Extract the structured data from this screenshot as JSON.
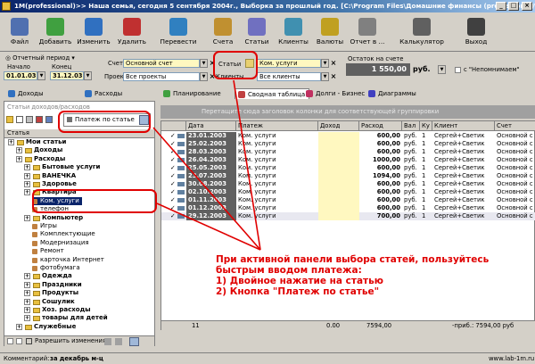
{
  "window": {
    "title": "1М(professional)>> Наша семья, сегодня 5 сентября 2004г., Выборка за прошлый год. [C:\\Program Files\\Домашние финансы (professional)\\0..."
  },
  "toolbar": {
    "items": [
      {
        "label": "Файл",
        "icon": "file-icon",
        "color": "#5070b0"
      },
      {
        "label": "Добавить",
        "icon": "add-icon",
        "color": "#40a040"
      },
      {
        "label": "Изменить",
        "icon": "edit-icon",
        "color": "#3070c0"
      },
      {
        "label": "Удалить",
        "icon": "delete-icon",
        "color": "#c03030"
      },
      {
        "label": "Перевести",
        "icon": "transfer-icon",
        "color": "#3080c0"
      },
      {
        "label": "Счета",
        "icon": "accounts-icon",
        "color": "#c09030"
      },
      {
        "label": "Статьи",
        "icon": "articles-icon",
        "color": "#7070c0"
      },
      {
        "label": "Клиенты",
        "icon": "clients-icon",
        "color": "#4090b0"
      },
      {
        "label": "Валюты",
        "icon": "currency-icon",
        "color": "#c0a020"
      },
      {
        "label": "Отчет в ...",
        "icon": "report-icon",
        "color": "#808080"
      },
      {
        "label": "Калькулятор",
        "icon": "calculator-icon",
        "color": "#606060"
      },
      {
        "label": "Выход",
        "icon": "exit-icon",
        "color": "#404040"
      }
    ]
  },
  "filters": {
    "period_label": "Отчетный период",
    "start_label": "Начало",
    "end_label": "Конец",
    "start_value": "01.01.03",
    "end_value": "31.12.03",
    "account_label": "Счет",
    "account_value": "Основной счет",
    "project_label": "Проект",
    "project_value": "Все проекты",
    "articles_label": "Статьи",
    "articles_value": "Ком. услуги",
    "clients_label": "Клиенты",
    "clients_value": "Все клиенты",
    "balance_label": "Остаток на счете",
    "balance_value": "1 550,00",
    "currency": "руб.",
    "unmemorable_label": "с \"Непомнимаем\""
  },
  "tabs": [
    {
      "label": "Доходы",
      "color": "#3070c0"
    },
    {
      "label": "Расходы",
      "color": "#3070c0"
    },
    {
      "label": "Планирование",
      "color": "#40a040"
    },
    {
      "label": "Сводная таблица",
      "color": "#c04040"
    },
    {
      "label": "Долги - Бизнес",
      "color": "#c03060"
    },
    {
      "label": "Диаграммы",
      "color": "#4040c0"
    }
  ],
  "left": {
    "header": "Статьи доходов/расходов",
    "button_label": "Платеж по статье",
    "col_header": "Статья",
    "tree": [
      {
        "label": "Мои статьи",
        "level": 0,
        "type": "exp",
        "bold": true
      },
      {
        "label": "Доходы",
        "level": 1,
        "type": "exp",
        "bold": true
      },
      {
        "label": "Расходы",
        "level": 1,
        "type": "exp",
        "bold": true
      },
      {
        "label": "Бытовые услуги",
        "level": 2,
        "type": "exp",
        "bold": true
      },
      {
        "label": "ВАНЕЧКА",
        "level": 2,
        "type": "exp",
        "bold": true
      },
      {
        "label": "Здоровье",
        "level": 2,
        "type": "exp",
        "bold": true
      },
      {
        "label": "Квартира",
        "level": 2,
        "type": "exp",
        "bold": true
      },
      {
        "label": "Ком. услуги",
        "level": 3,
        "type": "leaf",
        "selected": true
      },
      {
        "label": "телефон",
        "level": 3,
        "type": "leaf"
      },
      {
        "label": "Компьютер",
        "level": 2,
        "type": "exp",
        "bold": true
      },
      {
        "label": "Игры",
        "level": 3,
        "type": "leaf"
      },
      {
        "label": "Комплектующие",
        "level": 3,
        "type": "leaf"
      },
      {
        "label": "Модернизация",
        "level": 3,
        "type": "leaf"
      },
      {
        "label": "Ремонт",
        "level": 3,
        "type": "leaf"
      },
      {
        "label": "карточка Интернет",
        "level": 3,
        "type": "leaf"
      },
      {
        "label": "фотобумага",
        "level": 3,
        "type": "leaf"
      },
      {
        "label": "Одежда",
        "level": 2,
        "type": "exp",
        "bold": true
      },
      {
        "label": "Праздники",
        "level": 2,
        "type": "exp",
        "bold": true
      },
      {
        "label": "Продукты",
        "level": 2,
        "type": "exp",
        "bold": true
      },
      {
        "label": "Сошулик",
        "level": 2,
        "type": "exp",
        "bold": true
      },
      {
        "label": "Хоз. расходы",
        "level": 2,
        "type": "exp",
        "bold": true
      },
      {
        "label": "товары для детей",
        "level": 2,
        "type": "exp",
        "bold": true
      },
      {
        "label": "Служебные",
        "level": 1,
        "type": "exp",
        "bold": true
      }
    ],
    "bottom_label": "Разрешить изменения"
  },
  "grid": {
    "group_hint": "Перетащите сюда заголовок колонки для соответствующей группировки",
    "columns": [
      "Дата",
      "Платеж",
      "Доход",
      "Расход",
      "Вал",
      "Ку",
      "Клиент",
      "Счет"
    ],
    "rows": [
      {
        "date": "23.01.2003",
        "payment": "Ком. услуги",
        "income": "",
        "expense": "600,00",
        "cur": "руб.",
        "rate": "1",
        "client": "Сергей+Светик",
        "account": "Основной с"
      },
      {
        "date": "25.02.2003",
        "payment": "Ком. услуги",
        "income": "",
        "expense": "600,00",
        "cur": "руб.",
        "rate": "1",
        "client": "Сергей+Светик",
        "account": "Основной с"
      },
      {
        "date": "28.03.2003",
        "payment": "Ком. услуги",
        "income": "",
        "expense": "600,00",
        "cur": "руб.",
        "rate": "1",
        "client": "Сергей+Светик",
        "account": "Основной с"
      },
      {
        "date": "26.04.2003",
        "payment": "Ком. услуги",
        "income": "",
        "expense": "1000,00",
        "cur": "руб.",
        "rate": "1",
        "client": "Сергей+Светик",
        "account": "Основной с"
      },
      {
        "date": "25.05.2003",
        "payment": "Ком. услуги",
        "income": "",
        "expense": "600,00",
        "cur": "руб.",
        "rate": "1",
        "client": "Сергей+Светик",
        "account": "Основной с"
      },
      {
        "date": "23.07.2003",
        "payment": "Ком. услуги",
        "income": "",
        "expense": "1094,00",
        "cur": "руб.",
        "rate": "1",
        "client": "Сергей+Светик",
        "account": "Основной с"
      },
      {
        "date": "30.08.2003",
        "payment": "Ком. услуги",
        "income": "",
        "expense": "600,00",
        "cur": "руб.",
        "rate": "1",
        "client": "Сергей+Светик",
        "account": "Основной с"
      },
      {
        "date": "02.10.2003",
        "payment": "Ком. услуги",
        "income": "",
        "expense": "600,00",
        "cur": "руб.",
        "rate": "1",
        "client": "Сергей+Светик",
        "account": "Основной с"
      },
      {
        "date": "01.11.2003",
        "payment": "Ком. услуги",
        "income": "",
        "expense": "600,00",
        "cur": "руб.",
        "rate": "1",
        "client": "Сергей+Светик",
        "account": "Основной с"
      },
      {
        "date": "01.12.2003",
        "payment": "Ком. услуги",
        "income": "",
        "expense": "600,00",
        "cur": "руб.",
        "rate": "1",
        "client": "Сергей+Светик",
        "account": "Основной с"
      },
      {
        "date": "29.12.2003",
        "payment": "Ком. услуги",
        "income": "",
        "expense": "700,00",
        "cur": "руб.",
        "rate": "1",
        "client": "Сергей+Светик",
        "account": "Основной с"
      }
    ],
    "footer_count": "11",
    "footer_income": "0.00",
    "footer_expense": "7594,00",
    "footer_note": "-приб.: 7594,00 руб"
  },
  "annotation": {
    "line1": "При активной панели выбора статей, пользуйтесь",
    "line2": "быстрым вводом платежа:",
    "line3": "1) Двойное нажатие на статью",
    "line4": "2) Кнопка \"Платеж по статье\""
  },
  "status": {
    "label": "Комментарий:",
    "value": "за декабрь м-ц",
    "site": "www.lab-1m.ru"
  }
}
